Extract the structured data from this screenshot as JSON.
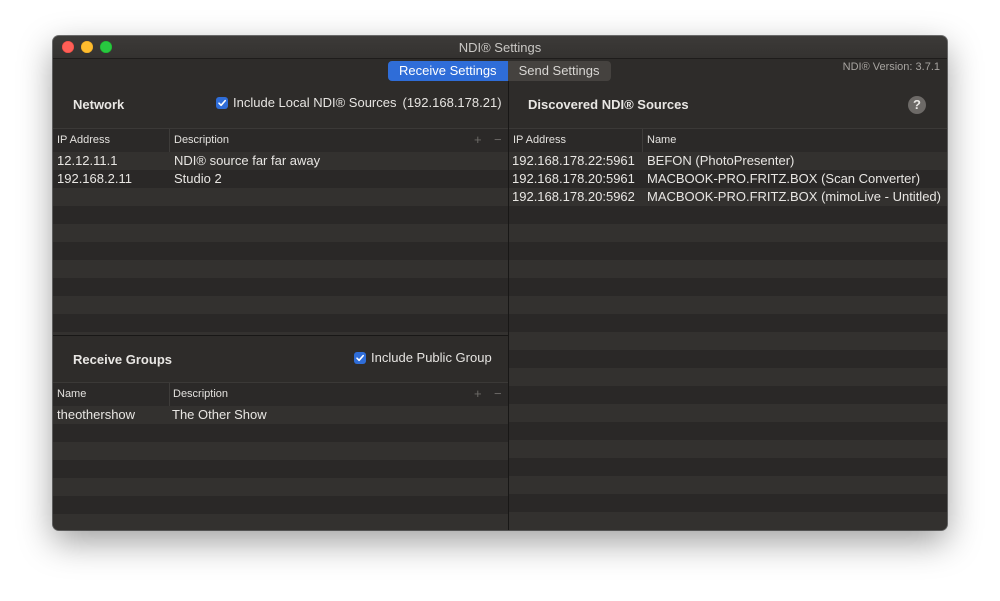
{
  "window": {
    "title": "NDI® Settings"
  },
  "tabs": [
    {
      "label": "Receive Settings",
      "active": true
    },
    {
      "label": "Send Settings",
      "active": false
    }
  ],
  "version": "NDI® Version: 3.7.1",
  "network": {
    "title": "Network",
    "include_local": {
      "label": "Include Local NDI® Sources",
      "checked": true,
      "ip": "(192.168.178.21)"
    },
    "columns": [
      "IP Address",
      "Description"
    ],
    "rows": [
      {
        "ip": "12.12.11.1",
        "description": "NDI® source far far away"
      },
      {
        "ip": "192.168.2.11",
        "description": "Studio 2"
      }
    ],
    "add_label": "+",
    "remove_label": "−"
  },
  "receive_groups": {
    "title": "Receive Groups",
    "include_public": {
      "label": "Include Public Group",
      "checked": true
    },
    "columns": [
      "Name",
      "Description"
    ],
    "rows": [
      {
        "name": "theothershow",
        "description": "The Other Show"
      }
    ],
    "add_label": "+",
    "remove_label": "−"
  },
  "discovered": {
    "title": "Discovered NDI® Sources",
    "help_label": "?",
    "columns": [
      "IP Address",
      "Name"
    ],
    "rows": [
      {
        "ip": "192.168.178.22:5961",
        "name": "BEFON (PhotoPresenter)"
      },
      {
        "ip": "192.168.178.20:5961",
        "name": "MACBOOK-PRO.FRITZ.BOX (Scan Converter)"
      },
      {
        "ip": "192.168.178.20:5962",
        "name": "MACBOOK-PRO.FRITZ.BOX (mimoLive - Untitled)"
      }
    ]
  },
  "colors": {
    "accent": "#2f6dd8",
    "window_bg": "#2e2c2a"
  }
}
